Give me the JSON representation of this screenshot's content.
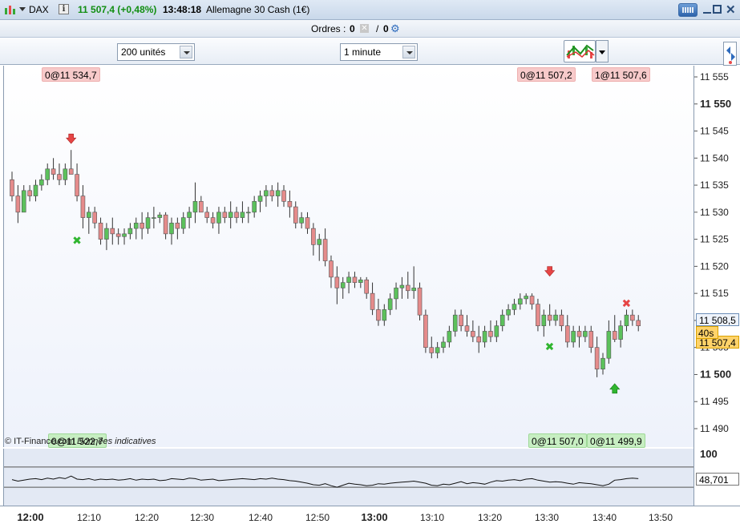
{
  "header": {
    "symbol": "DAX",
    "price_change": "11 507,4 (+0,48%)",
    "time": "13:48:18",
    "instrument_name": "Allemagne 30 Cash (1€)"
  },
  "orders": {
    "label": "Ordres :",
    "count": "0",
    "slash": "/",
    "count2": "0"
  },
  "toolbar": {
    "units_select": "200 unités",
    "period_select": "1 minute"
  },
  "order_tags": {
    "top": [
      "0@11 534,7",
      "0@11 507,2",
      "1@11 507,6"
    ],
    "bottom": [
      "0@11 522,7",
      "0@11 507,0",
      "0@11 499,9"
    ]
  },
  "watermark": {
    "source": "© IT-Finance.com",
    "note": "Données indicatives"
  },
  "price_boxes": {
    "current": "11 508,5",
    "countdown": "40s",
    "close": "11 507,4",
    "indicator": "48,701"
  },
  "colors": {
    "up": "#5cc15c",
    "down": "#e58b8b",
    "price_up_text": "#128e12",
    "buy_marker": "#2fb52f",
    "sell_marker": "#e64545"
  },
  "chart_data": {
    "type": "candlestick",
    "ylim": [
      11486,
      11556
    ],
    "y_ticks": [
      "11 555",
      "11 550",
      "11 545",
      "11 540",
      "11 535",
      "11 530",
      "11 525",
      "11 520",
      "11 515",
      "11 510",
      "11 505",
      "11 500",
      "11 495",
      "11 490"
    ],
    "y_ticks_bold": [
      "11 550",
      "11 500"
    ],
    "x_tick_labels": [
      "12:00",
      "12:10",
      "12:20",
      "12:30",
      "12:40",
      "12:50",
      "13:00",
      "13:10",
      "13:20",
      "13:30",
      "13:40",
      "13:50"
    ],
    "x_tick_bold": [
      "12:00",
      "13:00"
    ],
    "candles": [
      [
        11536,
        11537.5,
        11532,
        11533
      ],
      [
        11533,
        11535,
        11528,
        11530
      ],
      [
        11530,
        11535,
        11530,
        11534
      ],
      [
        11534,
        11535,
        11532,
        11533
      ],
      [
        11533,
        11536,
        11532,
        11535
      ],
      [
        11535,
        11537,
        11534,
        11536
      ],
      [
        11536,
        11539,
        11535,
        11538
      ],
      [
        11538,
        11540,
        11536,
        11537
      ],
      [
        11537,
        11539,
        11535,
        11536
      ],
      [
        11536,
        11539,
        11535,
        11538
      ],
      [
        11538,
        11541.5,
        11537,
        11537
      ],
      [
        11537,
        11539,
        11532,
        11533
      ],
      [
        11533,
        11535,
        11527,
        11529
      ],
      [
        11529,
        11531,
        11526,
        11530
      ],
      [
        11530,
        11531,
        11527,
        11528
      ],
      [
        11528,
        11529,
        11524,
        11525
      ],
      [
        11525,
        11528,
        11523,
        11527
      ],
      [
        11527,
        11529,
        11524,
        11526
      ],
      [
        11526,
        11527,
        11524,
        11525.5
      ],
      [
        11525.5,
        11527,
        11524,
        11526
      ],
      [
        11526,
        11528,
        11525,
        11527
      ],
      [
        11527,
        11529,
        11525,
        11528
      ],
      [
        11528,
        11530,
        11525,
        11527
      ],
      [
        11527,
        11530,
        11526,
        11529
      ],
      [
        11529,
        11531,
        11527,
        11529
      ],
      [
        11529,
        11530,
        11528,
        11529.5
      ],
      [
        11529.5,
        11530,
        11525,
        11526
      ],
      [
        11526,
        11529,
        11524,
        11528
      ],
      [
        11528,
        11529,
        11525,
        11527
      ],
      [
        11527,
        11530,
        11526,
        11529
      ],
      [
        11529,
        11531,
        11527,
        11530
      ],
      [
        11530,
        11535.5,
        11528,
        11532
      ],
      [
        11532,
        11533,
        11530,
        11530
      ],
      [
        11530,
        11531,
        11528,
        11529
      ],
      [
        11529,
        11530,
        11527,
        11528
      ],
      [
        11528,
        11531,
        11526,
        11530
      ],
      [
        11530,
        11531,
        11528,
        11529
      ],
      [
        11529,
        11532,
        11527,
        11530
      ],
      [
        11530,
        11531,
        11528,
        11529
      ],
      [
        11529,
        11532,
        11528,
        11530
      ],
      [
        11530,
        11531,
        11528,
        11530
      ],
      [
        11530,
        11533,
        11529,
        11532
      ],
      [
        11532,
        11534,
        11530,
        11533
      ],
      [
        11533,
        11535,
        11531,
        11534
      ],
      [
        11534,
        11535,
        11532,
        11533
      ],
      [
        11533,
        11535.5,
        11531,
        11534
      ],
      [
        11534,
        11535,
        11531,
        11532
      ],
      [
        11532,
        11534,
        11529,
        11531
      ],
      [
        11531,
        11532,
        11527,
        11528
      ],
      [
        11528,
        11530,
        11527,
        11529
      ],
      [
        11529,
        11530,
        11526,
        11527
      ],
      [
        11527,
        11528,
        11522,
        11524
      ],
      [
        11524,
        11526,
        11521,
        11525
      ],
      [
        11525,
        11527,
        11520,
        11521
      ],
      [
        11521,
        11522,
        11516,
        11518
      ],
      [
        11518,
        11520,
        11513,
        11516
      ],
      [
        11516,
        11518,
        11514,
        11517
      ],
      [
        11517,
        11519,
        11515,
        11518
      ],
      [
        11518,
        11519,
        11516,
        11517
      ],
      [
        11517,
        11518,
        11516,
        11517.5
      ],
      [
        11517.5,
        11518,
        11514,
        11515
      ],
      [
        11515,
        11517,
        11511,
        11512
      ],
      [
        11512,
        11514,
        11509,
        11510
      ],
      [
        11510,
        11513,
        11509,
        11512
      ],
      [
        11512,
        11515,
        11511,
        11514
      ],
      [
        11514,
        11517,
        11512,
        11516
      ],
      [
        11516,
        11518,
        11514,
        11516.5
      ],
      [
        11516.5,
        11519,
        11514,
        11515.5
      ],
      [
        11515.5,
        11520,
        11514,
        11516
      ],
      [
        11516,
        11517,
        11510,
        11511
      ],
      [
        11511,
        11512,
        11504,
        11505
      ],
      [
        11505,
        11507,
        11503,
        11504
      ],
      [
        11504,
        11506,
        11503,
        11505
      ],
      [
        11505,
        11507,
        11504,
        11506
      ],
      [
        11506,
        11509,
        11505,
        11508
      ],
      [
        11508,
        11512,
        11507,
        11511
      ],
      [
        11511,
        11512,
        11508,
        11509
      ],
      [
        11509,
        11511,
        11507,
        11508
      ],
      [
        11508,
        11510,
        11506,
        11507
      ],
      [
        11507,
        11509,
        11504,
        11506
      ],
      [
        11506,
        11509,
        11505,
        11508
      ],
      [
        11508,
        11510,
        11506,
        11507
      ],
      [
        11507,
        11510,
        11506,
        11509
      ],
      [
        11509,
        11512,
        11508,
        11511
      ],
      [
        11511,
        11513,
        11510,
        11512
      ],
      [
        11512,
        11514,
        11511,
        11513
      ],
      [
        11513,
        11515,
        11512,
        11514
      ],
      [
        11514,
        11515,
        11513,
        11514.5
      ],
      [
        11514.5,
        11515,
        11512,
        11513
      ],
      [
        11513,
        11514,
        11508,
        11509
      ],
      [
        11509,
        11512,
        11507,
        11511
      ],
      [
        11511,
        11513,
        11509,
        11510
      ],
      [
        11510,
        11512,
        11509,
        11511
      ],
      [
        11511,
        11512,
        11508,
        11509
      ],
      [
        11509,
        11511,
        11505,
        11506
      ],
      [
        11506,
        11509,
        11505,
        11508
      ],
      [
        11508,
        11509,
        11505,
        11507
      ],
      [
        11507,
        11509,
        11506,
        11508
      ],
      [
        11508,
        11509,
        11504,
        11505
      ],
      [
        11505,
        11507,
        11499.5,
        11501
      ],
      [
        11501,
        11504,
        11500,
        11503
      ],
      [
        11503,
        11510,
        11502,
        11508
      ],
      [
        11508,
        11511,
        11506,
        11506.5
      ],
      [
        11506.5,
        11510,
        11505,
        11509
      ],
      [
        11509,
        11512,
        11508,
        11511
      ],
      [
        11511,
        11512,
        11509,
        11510
      ],
      [
        11510,
        11511,
        11508,
        11509
      ]
    ],
    "oscillator": {
      "label": "48,701",
      "axis_label": "100",
      "levels": [
        70,
        30
      ],
      "ylim": [
        0,
        100
      ],
      "values": [
        45,
        42,
        44,
        46,
        47,
        45,
        48,
        46,
        49,
        47,
        52,
        46,
        45,
        47,
        44,
        46,
        45,
        46,
        44,
        45,
        47,
        44,
        46,
        45,
        46,
        43,
        44,
        47,
        46,
        45,
        48,
        47,
        44,
        45,
        46,
        43,
        44,
        45,
        46,
        47,
        46,
        45,
        47,
        46,
        48,
        46,
        45,
        43,
        42,
        40,
        38,
        35,
        34,
        37,
        33,
        30,
        34,
        38,
        36,
        35,
        33,
        34,
        37,
        36,
        38,
        39,
        40,
        41,
        42,
        40,
        38,
        34,
        33,
        36,
        35,
        38,
        41,
        37,
        39,
        38,
        36,
        40,
        43,
        42,
        44,
        45,
        43,
        46,
        47,
        44,
        42,
        40,
        41,
        40,
        38,
        36,
        39,
        38,
        37,
        35,
        33,
        36,
        44,
        45,
        47,
        48,
        47
      ]
    }
  }
}
